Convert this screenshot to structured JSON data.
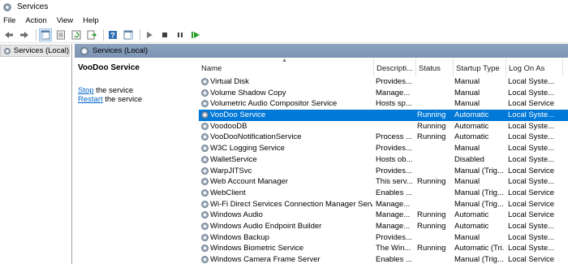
{
  "window": {
    "title": "Services"
  },
  "menu": [
    "File",
    "Action",
    "View",
    "Help"
  ],
  "tree": {
    "item": "Services (Local)"
  },
  "main": {
    "header": "Services (Local)",
    "detail": {
      "service_name": "VooDoo Service",
      "stop_link": "Stop",
      "stop_suffix": " the service",
      "restart_link": "Restart",
      "restart_suffix": " the service"
    },
    "columns": [
      "Name",
      "Descripti...",
      "Status",
      "Startup Type",
      "Log On As"
    ],
    "rows": [
      {
        "name": "Virtual Disk",
        "desc": "Provides...",
        "status": "",
        "startup": "Manual",
        "logon": "Local Syste..."
      },
      {
        "name": "Volume Shadow Copy",
        "desc": "Manage...",
        "status": "",
        "startup": "Manual",
        "logon": "Local Syste..."
      },
      {
        "name": "Volumetric Audio Compositor Service",
        "desc": "Hosts sp...",
        "status": "",
        "startup": "Manual",
        "logon": "Local Service"
      },
      {
        "name": "VooDoo Service",
        "desc": "",
        "status": "Running",
        "startup": "Automatic",
        "logon": "Local Syste..."
      },
      {
        "name": "VoodooDB",
        "desc": "",
        "status": "Running",
        "startup": "Automatic",
        "logon": "Local Syste..."
      },
      {
        "name": "VooDooNotificationService",
        "desc": "Process ...",
        "status": "Running",
        "startup": "Automatic",
        "logon": "Local Syste..."
      },
      {
        "name": "W3C Logging Service",
        "desc": "Provides...",
        "status": "",
        "startup": "Manual",
        "logon": "Local Syste..."
      },
      {
        "name": "WalletService",
        "desc": "Hosts ob...",
        "status": "",
        "startup": "Disabled",
        "logon": "Local Syste..."
      },
      {
        "name": "WarpJITSvc",
        "desc": "Provides...",
        "status": "",
        "startup": "Manual (Trig...",
        "logon": "Local Service"
      },
      {
        "name": "Web Account Manager",
        "desc": "This serv...",
        "status": "Running",
        "startup": "Manual",
        "logon": "Local Syste..."
      },
      {
        "name": "WebClient",
        "desc": "Enables ...",
        "status": "",
        "startup": "Manual (Trig...",
        "logon": "Local Service"
      },
      {
        "name": "Wi-Fi Direct Services Connection Manager Service",
        "desc": "Manage...",
        "status": "",
        "startup": "Manual (Trig...",
        "logon": "Local Service"
      },
      {
        "name": "Windows Audio",
        "desc": "Manage...",
        "status": "Running",
        "startup": "Automatic",
        "logon": "Local Service"
      },
      {
        "name": "Windows Audio Endpoint Builder",
        "desc": "Manage...",
        "status": "Running",
        "startup": "Automatic",
        "logon": "Local Syste..."
      },
      {
        "name": "Windows Backup",
        "desc": "Provides...",
        "status": "",
        "startup": "Manual",
        "logon": "Local Syste..."
      },
      {
        "name": "Windows Biometric Service",
        "desc": "The Win...",
        "status": "Running",
        "startup": "Automatic (Tri...",
        "logon": "Local Syste..."
      },
      {
        "name": "Windows Camera Frame Server",
        "desc": "Enables ...",
        "status": "",
        "startup": "Manual (Trig...",
        "logon": "Local Service"
      }
    ],
    "selected_index": 3
  },
  "colors": {
    "selection": "#0078d7",
    "header_band": "#8da3bf",
    "link": "#0066cc"
  }
}
